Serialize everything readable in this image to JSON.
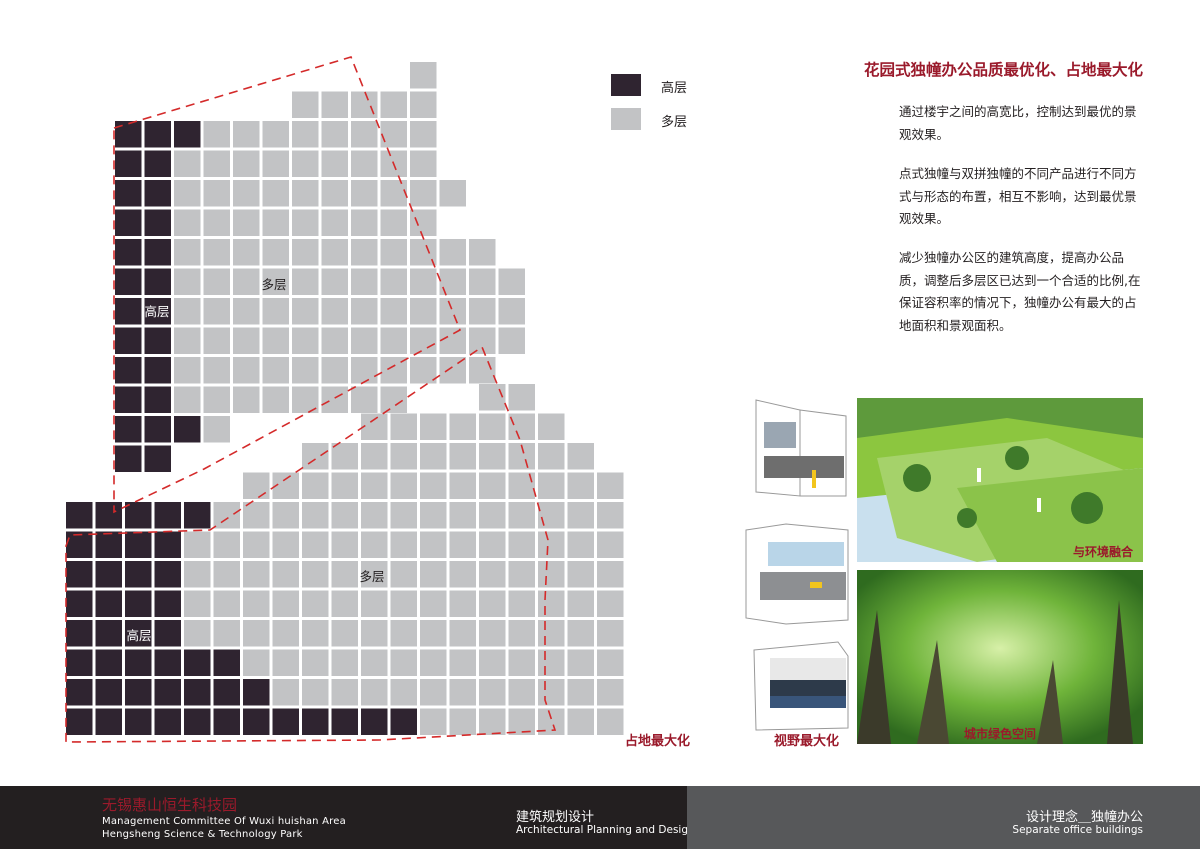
{
  "colors": {
    "high": "#2f2430",
    "mid": "#c2c3c5",
    "boundary": "#d42a2a",
    "accent": "#9a1a2b",
    "footer_dark": "#231f20",
    "footer_grey": "#57585a"
  },
  "legend": {
    "items": [
      {
        "label": "高层",
        "category": "high"
      },
      {
        "label": "多层",
        "category": "mid"
      }
    ]
  },
  "site": {
    "north": {
      "high_label": "高层",
      "mid_label": "多层",
      "cols": 11,
      "rows": 13,
      "grid": [
        "..........M",
        "......MMMMM",
        "HHHMMMMMMMM",
        "HHMMMMMMMMM",
        "HHMMMMMMMMMM",
        "HHMMMMMMMMM",
        "HHMMMMMMMMMMM",
        "HHMMMMMMMMMMMM",
        "HHMMMMMMMMMMMM",
        "HHMMMMMMMMMMMM",
        "HHMMMMMMMMMMM",
        "HHMMMMMMMM",
        "HHHM",
        "HH"
      ]
    },
    "south": {
      "high_label": "高层",
      "mid_label": "多层",
      "cols": 16,
      "rows": 8,
      "grid": [
        "..............MM",
        "..........MMMMMMM",
        "........MMMMMMMMMM",
        "......MMMMMMMMMMMMM",
        "HHHHHMMMMMMMMMMMMMM",
        "HHHHMMMMMMMMMMMMMMM",
        "HHHHMMMMMMMMMMMMMMM",
        "HHHHMMMMMMMMMMMMMMM",
        "HHHHMMMMMMMMMMMMMMM",
        "HHHHHHMMMMMMMMMMMMM",
        "HHHHHHHMMMMMMMMMMMM",
        "HHHHHHHHHHHHMMMMMMM"
      ]
    },
    "caption": "占地最大化"
  },
  "content": {
    "heading": "花园式独幢办公品质最优化、占地最大化",
    "paragraphs": [
      "通过楼宇之间的高宽比，控制达到最优的景观效果。",
      "点式独幢与双拼独幢的不同产品进行不同方式与形态的布置，相互不影响，达到最优景观效果。",
      "减少独幢办公区的建筑高度，提高办公品质，调整后多层区已达到一个合适的比例,在保证容积率的情况下，独幢办公有最大的占地面积和景观面积。"
    ]
  },
  "images": {
    "caption_view": "视野最大化",
    "caption_env": "与环境融合",
    "caption_green": "城市绿色空间"
  },
  "footer": {
    "title_cn": "无锡惠山恒生科技园",
    "title_en_1": "Management   Committee  Of  Wuxi huishan  Area",
    "title_en_2": "Hengsheng Science & Technology Park",
    "section_cn": "建筑规划设计",
    "section_en": "Architectural Planning and Design",
    "page_cn": "设计理念＿独幢办公",
    "page_en": "Separate office buildings"
  }
}
